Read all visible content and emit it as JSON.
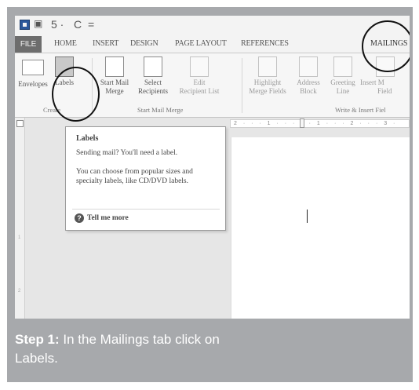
{
  "quick_access": {
    "undo": "5 ·",
    "redo": "C",
    "more": "="
  },
  "tabs": [
    "FILE",
    "HOME",
    "INSERT",
    "DESIGN",
    "PAGE LAYOUT",
    "REFERENCES",
    "MAILINGS"
  ],
  "ribbon": {
    "envelopes": "Envelopes",
    "labels": "Labels",
    "start_mail_merge": [
      "Start Mail",
      "Merge"
    ],
    "select_recipients": [
      "Select",
      "Recipients"
    ],
    "edit_recipient_list": [
      "Edit",
      "Recipient List"
    ],
    "highlight_merge_fields": [
      "Highlight",
      "Merge Fields"
    ],
    "address_block": [
      "Address",
      "Block"
    ],
    "greeting_line": [
      "Greeting",
      "Line"
    ],
    "insert_merge_field": [
      "Insert M",
      "Field"
    ],
    "group_create": "Create",
    "group_start_mail_merge": "Start Mail Merge",
    "group_write_insert": "Write & Insert Fiel"
  },
  "ruler": {
    "h_ticks": "2 · · · 1 · · · · · 1 · · · 2 · · · 3 ·",
    "v_ticks": [
      "1",
      "2"
    ]
  },
  "tooltip": {
    "title": "Labels",
    "line1": "Sending mail? You'll need a label.",
    "line2": "You can choose from popular sizes and specialty labels, like CD/DVD labels.",
    "tell_more": "Tell me more"
  },
  "caption": {
    "step": "Step 1:",
    "text": " In the Mailings tab click on Labels."
  }
}
